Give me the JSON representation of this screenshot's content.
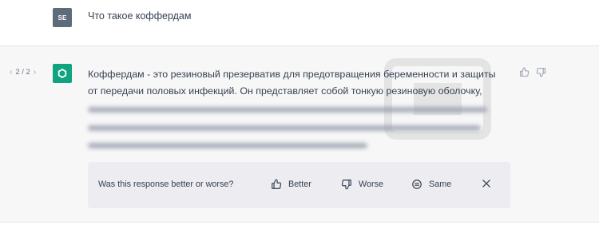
{
  "user_message": {
    "avatar_initials": "SE",
    "text": "Что такое коффердам"
  },
  "assistant_message": {
    "pager": "2 / 2",
    "lines": [
      "Коффердам - это резиновый презерватив для предотвращения беременности и защиты",
      "от передачи половых инфекций. Он представляет собой тонкую резиновую оболочку,"
    ],
    "icons": {
      "avatar": "openai-logo-icon",
      "thumbs_up": "thumbs-up-icon",
      "thumbs_down": "thumbs-down-icon"
    }
  },
  "feedback": {
    "question": "Was this response better or worse?",
    "better_label": "Better",
    "worse_label": "Worse",
    "same_label": "Same"
  },
  "colors": {
    "assistant_bg": "#f7f7f8",
    "feedback_bg": "#ececf1",
    "brand_green": "#10a37f",
    "user_avatar": "#5e6b7a"
  }
}
